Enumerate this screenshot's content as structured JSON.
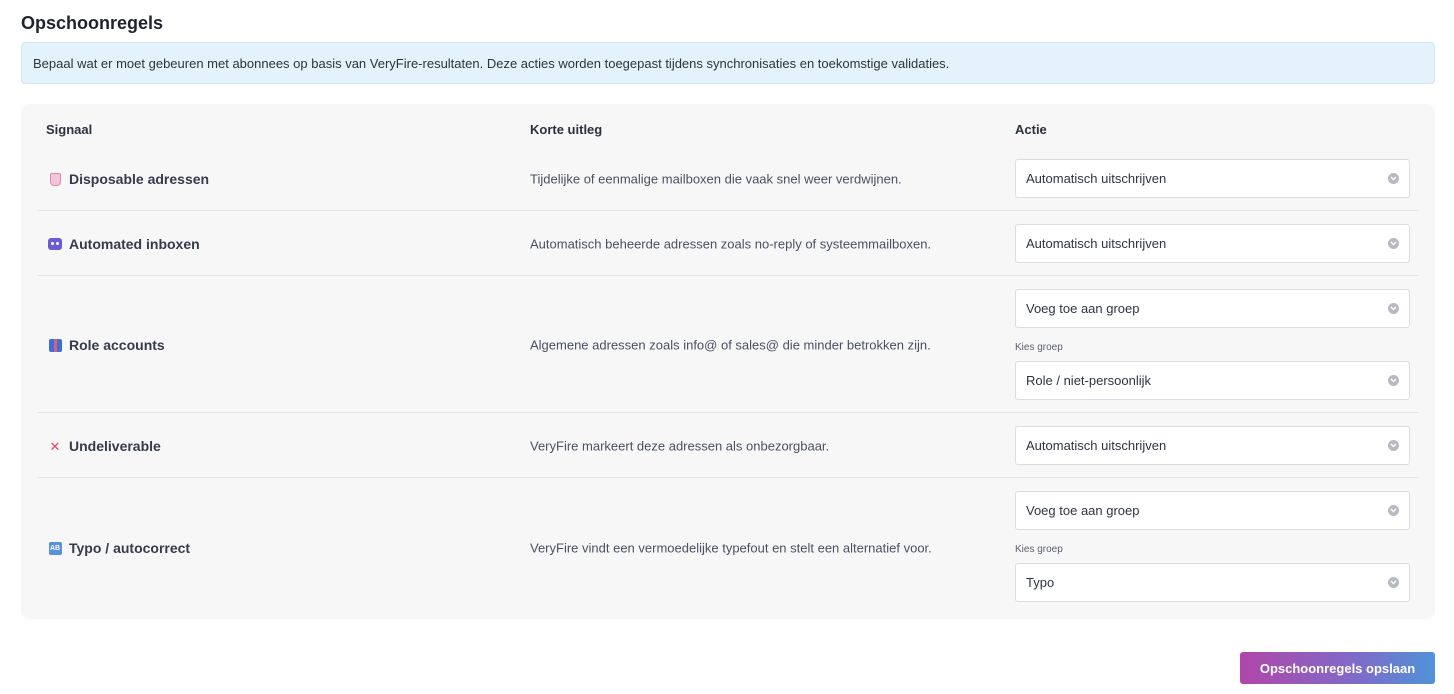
{
  "page": {
    "title": "Opschoonregels",
    "info": "Bepaal wat er moet gebeuren met abonnees op basis van VeryFire-resultaten. Deze acties worden toegepast tijdens synchronisaties en toekomstige validaties."
  },
  "table": {
    "headers": {
      "signal": "Signaal",
      "explain": "Korte uitleg",
      "action": "Actie"
    },
    "rows": [
      {
        "icon": "disposable-icon",
        "signal": "Disposable adressen",
        "explain": "Tijdelijke of eenmalige mailboxen die vaak snel weer verdwijnen.",
        "action": "Automatisch uitschrijven"
      },
      {
        "icon": "robot-icon",
        "signal": "Automated inboxen",
        "explain": "Automatisch beheerde adressen zoals no-reply of systeemmailboxen.",
        "action": "Automatisch uitschrijven"
      },
      {
        "icon": "role-icon",
        "signal": "Role accounts",
        "explain": "Algemene adressen zoals info@ of sales@ die minder betrokken zijn.",
        "action": "Voeg toe aan groep",
        "group_label": "Kies groep",
        "group": "Role / niet-persoonlijk"
      },
      {
        "icon": "cross-icon",
        "icon_glyph": "✕",
        "signal": "Undeliverable",
        "explain": "VeryFire markeert deze adressen als onbezorgbaar.",
        "action": "Automatisch uitschrijven"
      },
      {
        "icon": "typo-icon",
        "icon_glyph": "AB",
        "signal": "Typo / autocorrect",
        "explain": "VeryFire vindt een vermoedelijke typefout en stelt een alternatief voor.",
        "action": "Voeg toe aan groep",
        "group_label": "Kies groep",
        "group": "Typo"
      }
    ]
  },
  "save_button": "Opschoonregels opslaan",
  "colors": {
    "banner_bg": "#e3f2fb",
    "card_bg": "#f7f7f8",
    "button_gradient_start": "#b046a8",
    "button_gradient_end": "#4f93d8"
  }
}
